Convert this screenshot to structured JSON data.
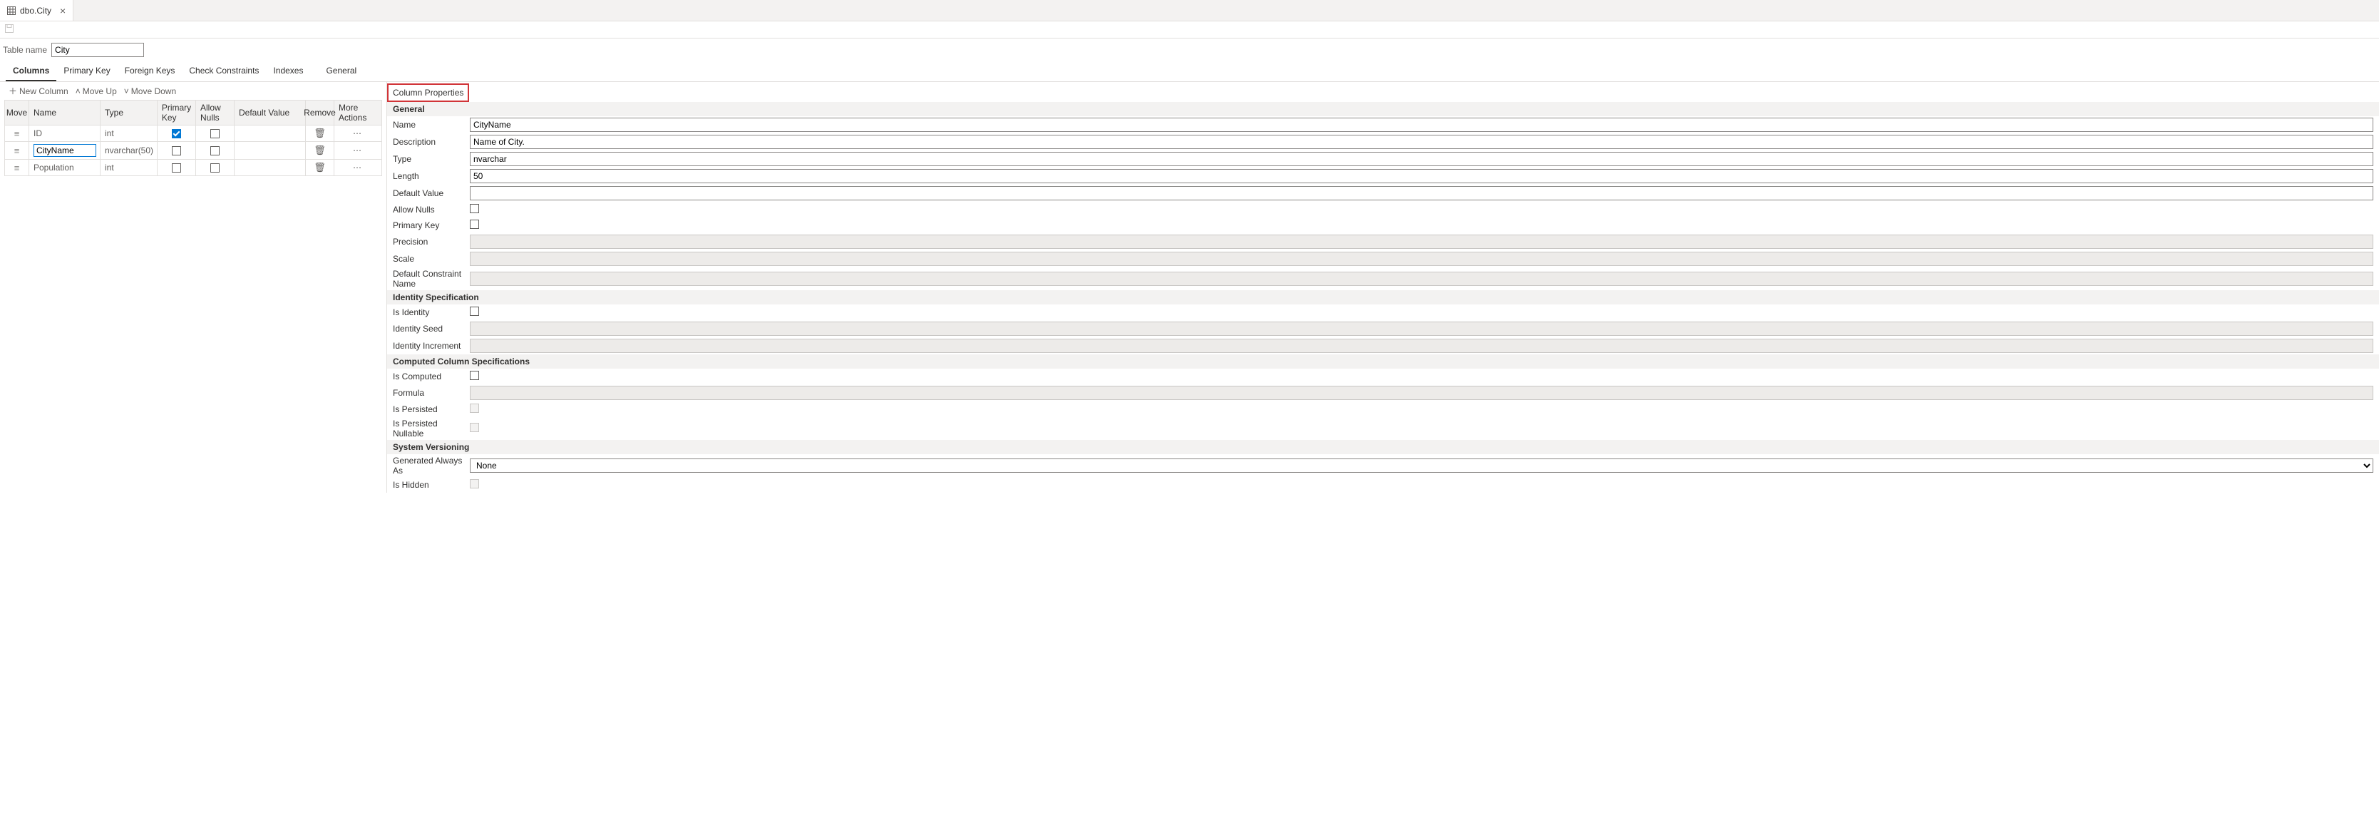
{
  "tab": {
    "title": "dbo.City"
  },
  "tableName": {
    "label": "Table name",
    "value": "City"
  },
  "designTabs": {
    "columns": "Columns",
    "primaryKey": "Primary Key",
    "foreignKeys": "Foreign Keys",
    "checkConstraints": "Check Constraints",
    "indexes": "Indexes",
    "general": "General"
  },
  "actions": {
    "newColumn": "New Column",
    "moveUp": "Move Up",
    "moveDown": "Move Down"
  },
  "gridHeaders": {
    "move": "Move",
    "name": "Name",
    "type": "Type",
    "primaryKey": "Primary Key",
    "allowNulls": "Allow Nulls",
    "defaultValue": "Default Value",
    "remove": "Remove",
    "moreActions": "More Actions"
  },
  "rows": [
    {
      "name": "ID",
      "type": "int",
      "pk": true,
      "nulls": false
    },
    {
      "name": "CityName",
      "type": "nvarchar(50)",
      "pk": false,
      "nulls": false,
      "editing": true
    },
    {
      "name": "Population",
      "type": "int",
      "pk": false,
      "nulls": false
    }
  ],
  "panel": {
    "title": "Column Properties",
    "sections": {
      "general": "General",
      "identity": "Identity Specification",
      "computed": "Computed Column Specifications",
      "versioning": "System Versioning"
    },
    "labels": {
      "name": "Name",
      "description": "Description",
      "type": "Type",
      "length": "Length",
      "defaultValue": "Default Value",
      "allowNulls": "Allow Nulls",
      "primaryKey": "Primary Key",
      "precision": "Precision",
      "scale": "Scale",
      "defaultConstraintName": "Default Constraint Name",
      "isIdentity": "Is Identity",
      "identitySeed": "Identity Seed",
      "identityIncrement": "Identity Increment",
      "isComputed": "Is Computed",
      "formula": "Formula",
      "isPersisted": "Is Persisted",
      "isPersistedNullable": "Is Persisted Nullable",
      "generatedAlwaysAs": "Generated Always As",
      "isHidden": "Is Hidden"
    },
    "values": {
      "name": "CityName",
      "description": "Name of City.",
      "type": "nvarchar",
      "length": "50",
      "defaultValue": "",
      "allowNulls": false,
      "primaryKey": false,
      "precision": "",
      "scale": "",
      "defaultConstraintName": "",
      "isIdentity": false,
      "identitySeed": "",
      "identityIncrement": "",
      "isComputed": false,
      "formula": "",
      "isPersisted": false,
      "isPersistedNullable": false,
      "generatedAlwaysAs": "None",
      "isHidden": false
    }
  }
}
